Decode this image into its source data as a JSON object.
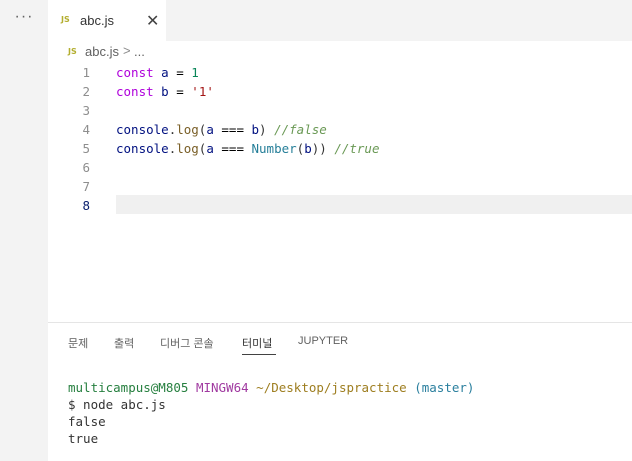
{
  "window": {
    "more_label": "···"
  },
  "tab": {
    "icon": "JS",
    "label": "abc.js",
    "close": "✕"
  },
  "breadcrumb": {
    "icon": "JS",
    "file": "abc.js",
    "separator": ">",
    "more": "..."
  },
  "editor": {
    "active_line": 8,
    "line_numbers": [
      "1",
      "2",
      "3",
      "4",
      "5",
      "6",
      "7",
      "8"
    ],
    "line1": {
      "kw": "const",
      "var": "a",
      "op": "=",
      "val": "1"
    },
    "line2": {
      "kw": "const",
      "var": "b",
      "op": "=",
      "val": "'1'"
    },
    "line4": {
      "obj": "console",
      "dot": ".",
      "fn": "log",
      "open": "(",
      "a": "a",
      "op": "===",
      "b": "b",
      "close": ")",
      "comment": "//false"
    },
    "line5": {
      "obj": "console",
      "dot": ".",
      "fn": "log",
      "open": "(",
      "a": "a",
      "op": "===",
      "cls": "Number",
      "open2": "(",
      "b": "b",
      "close": "))",
      "comment": "//true"
    }
  },
  "panel": {
    "tabs": [
      "문제",
      "출력",
      "디버그 콘솔",
      "터미널",
      "JUPYTER"
    ],
    "active_tab": "터미널"
  },
  "terminal": {
    "user": "multicampus@M805",
    "env": "MINGW64",
    "path": "~/Desktop/jspractice",
    "branch": "(master)",
    "command": "$ node abc.js",
    "output1": "false",
    "output2": "true"
  },
  "colors": {
    "keyword": "#af00db",
    "variable": "#001080",
    "number": "#098658",
    "string": "#a31515",
    "function": "#795e26",
    "class": "#267f99",
    "comment": "#6a9955"
  }
}
